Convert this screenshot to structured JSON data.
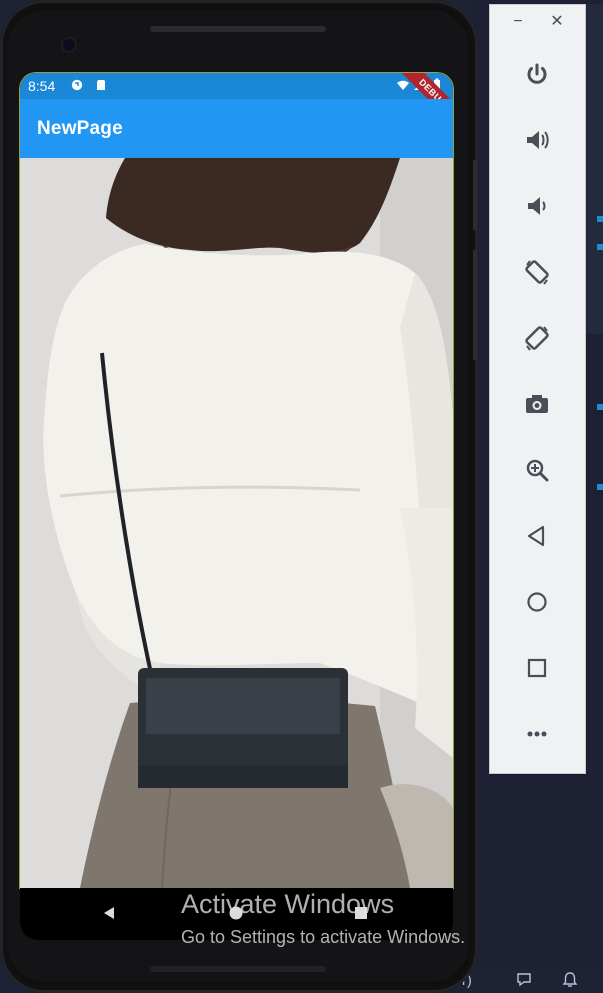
{
  "phone": {
    "status_bar": {
      "time": "8:54",
      "debug_banner": "DEBUG"
    },
    "app_bar": {
      "title": "NewPage"
    },
    "content": {
      "image": "photo of person wearing white blouse and black crossbody bag"
    }
  },
  "emulator_toolbar": {
    "buttons": [
      "power-icon",
      "volume-up-icon",
      "volume-down-icon",
      "rotate-left-icon",
      "rotate-right-icon",
      "camera-icon",
      "zoom-icon",
      "back-icon",
      "home-icon",
      "overview-icon",
      "more-icon"
    ]
  },
  "ide_status": {
    "text": "itor)"
  },
  "watermark": {
    "title": "Activate Windows",
    "subtitle": "Go to Settings to activate Windows."
  },
  "colors": {
    "app_bar": "#2196f3",
    "status_bar": "#1b87d7",
    "toolbar_bg": "#eff1f3",
    "toolbar_icon": "#4a4f57"
  }
}
